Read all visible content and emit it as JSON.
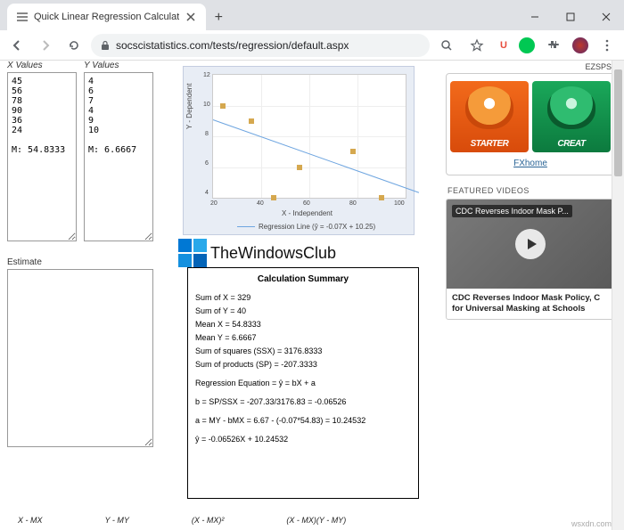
{
  "window": {
    "tab_title": "Quick Linear Regression Calculat",
    "url_display": "socscistatistics.com/tests/regression/default.aspx"
  },
  "ext": {
    "u": "U"
  },
  "left": {
    "x_header": "X Values",
    "y_header": "Y Values",
    "x_values": "45\n56\n78\n90\n36\n24\n\nM: 54.8333",
    "y_values": "4\n6\n7\n4\n9\n10\n\nM: 6.6667",
    "estimate_label": "Estimate"
  },
  "chart_data": {
    "type": "scatter",
    "x": [
      45,
      56,
      78,
      90,
      36,
      24
    ],
    "y": [
      4,
      6,
      7,
      4,
      9,
      10
    ],
    "regression": {
      "slope": -0.07,
      "intercept": 10.25
    },
    "xlabel": "X - Independent",
    "ylabel": "Y - Dependent",
    "xlim": [
      20,
      100
    ],
    "ylim": [
      4,
      12
    ],
    "xticks": [
      20,
      40,
      60,
      80,
      100
    ],
    "yticks": [
      4,
      6,
      8,
      10,
      12
    ],
    "legend": "Regression Line (ŷ = -0.07X + 10.25)"
  },
  "twc": {
    "text": "TheWindowsClub"
  },
  "summary": {
    "title": "Calculation Summary",
    "lines": {
      "sumx": "Sum of X = 329",
      "sumy": "Sum of Y = 40",
      "meanx": "Mean X = 54.8333",
      "meany": "Mean Y = 6.6667",
      "ssx": "Sum of squares (SSX) = 3176.8333",
      "sp": "Sum of products (SP) = -207.3333",
      "eq": "Regression Equation = ŷ = bX + a",
      "b": "b = SP/SSX = -207.33/3176.83 = -0.06526",
      "a": "a = MY - bMX = 6.67 - (-0.07*54.83) = 10.24532",
      "yhat": "ŷ = -0.06526X + 10.24532"
    }
  },
  "bottom": {
    "c1": "X - MX",
    "c2": "Y - MY",
    "c3": "(X - MX)²",
    "c4": "(X - MX)(Y - MY)"
  },
  "right": {
    "ezsps": "EZSPS",
    "starter": "STARTER",
    "creator": "CREAT",
    "fxhome": "FXhome",
    "featured": "FEATURED VIDEOS",
    "vid_overlay": "CDC Reverses Indoor Mask P...",
    "vid_caption": "CDC Reverses Indoor Mask Policy, C for Universal Masking at Schools"
  },
  "watermark": "wsxdn.com"
}
